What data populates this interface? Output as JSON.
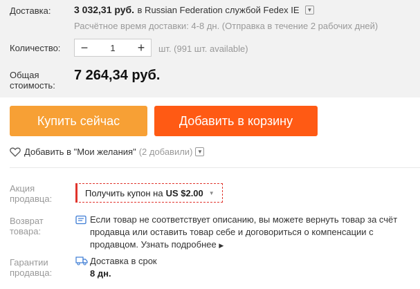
{
  "shipping": {
    "label": "Доставка:",
    "price": "3 032,31 руб.",
    "rest": "в Russian Federation службой Fedex IE",
    "estimate": "Расчётное время доставки: 4-8 дн. (Отправка в течение 2 рабочих дней)"
  },
  "quantity": {
    "label": "Количество:",
    "minus": "−",
    "value": "1",
    "plus": "+",
    "available": "шт. (991 шт. available)"
  },
  "total": {
    "label_line1": "Общая",
    "label_line2": "стоимость:",
    "value": "7 264,34 руб."
  },
  "buttons": {
    "buy_now": "Купить сейчас",
    "add_to_cart": "Добавить в корзину"
  },
  "wishlist": {
    "text": "Добавить в \"Мои желания\"",
    "count": "(2 добавили)"
  },
  "promo": {
    "label_line1": "Акция",
    "label_line2": "продавца:",
    "coupon_text": "Получить купон на",
    "coupon_amount": "US $2.00"
  },
  "return_policy": {
    "label_line1": "Возврат",
    "label_line2": "товара:",
    "text": "Если товар не соответствует описанию, вы можете вернуть товар за счёт продавца или оставить товар себе и договориться о компенсации с продавцом.",
    "link": "Узнать подробнее"
  },
  "guarantee": {
    "label_line1": "Гарантии",
    "label_line2": "продавца:",
    "title": "Доставка в срок",
    "days": "8 дн."
  },
  "colors": {
    "buy_now": "#f7a035",
    "add_to_cart": "#ff5a14",
    "coupon_border": "#e0342c",
    "panel_bg": "#f2f2f2"
  },
  "icons": [
    "chevron-down-icon",
    "heart-icon",
    "info-card-icon",
    "truck-icon"
  ]
}
